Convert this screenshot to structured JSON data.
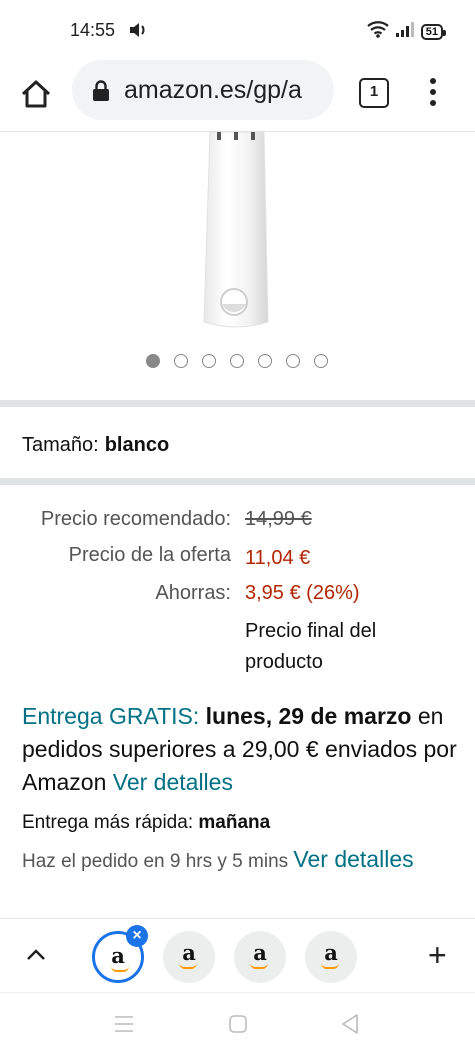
{
  "status": {
    "time": "14:55",
    "battery": "51"
  },
  "browser": {
    "url": "amazon.es/gp/a",
    "tab_count": "1"
  },
  "carousel": {
    "total_images": 7,
    "active_index": 0
  },
  "size": {
    "label": "Tamaño:",
    "value": "blanco"
  },
  "prices": {
    "recommended_label": "Precio recomendado:",
    "recommended_value": "14,99 €",
    "offer_label": "Precio de la oferta",
    "offer_value": "11,04 €",
    "savings_label": "Ahorras:",
    "savings_value": "3,95 € (26%)",
    "final_note": "Precio final del producto"
  },
  "delivery": {
    "free_label": "Entrega GRATIS:",
    "date": "lunes, 29 de marzo",
    "condition": "en pedidos superiores a 29,00 € enviados por Amazon",
    "details_link": "Ver detalles",
    "fastest_label": "Entrega más rápida:",
    "fastest_value": "mañana",
    "order_within": "Haz el pedido en 9 hrs y 5 mins",
    "order_link": "Ver detalles"
  },
  "tabs": {
    "letter": "a",
    "close": "×",
    "add": "+"
  },
  "colors": {
    "link_teal": "#007185",
    "price_red": "#b12704",
    "tab_active": "#1a73e8",
    "amazon_orange": "#ff9900"
  }
}
